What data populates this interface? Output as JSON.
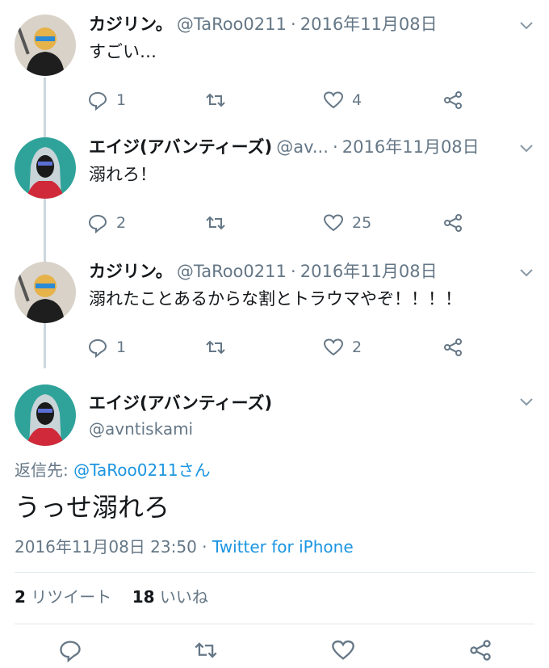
{
  "thread": [
    {
      "avatar_icon": "avatar-kajirin-icon",
      "name": "カジリン。",
      "handle": "@TaRoo0211",
      "separator": "·",
      "date": "2016年11月08日",
      "text": "すごい…",
      "replies": "1",
      "retweets": "",
      "likes": "4"
    },
    {
      "avatar_icon": "avatar-eiji-icon",
      "name": "エイジ(アバンティーズ)",
      "handle": "@av...",
      "separator": "·",
      "date": "2016年11月08日",
      "text": "溺れろ！",
      "replies": "2",
      "retweets": "",
      "likes": "25"
    },
    {
      "avatar_icon": "avatar-kajirin-icon",
      "name": "カジリン。",
      "handle": "@TaRoo0211",
      "separator": "·",
      "date": "2016年11月08日",
      "text": "溺れたことあるからな割とトラウマやぞ！！！！",
      "replies": "1",
      "retweets": "",
      "likes": "2"
    }
  ],
  "main_tweet": {
    "avatar_icon": "avatar-eiji-icon",
    "name": "エイジ(アバンティーズ)",
    "handle": "@avntiskami",
    "reply_label": "返信先: ",
    "reply_target": "@TaRoo0211さん",
    "text": "うっせ溺れろ",
    "timestamp": "2016年11月08日 23:50",
    "meta_separator": " · ",
    "client": "Twitter for iPhone",
    "retweet_count": "2",
    "retweet_label": " リツイート",
    "like_count": "18",
    "like_label": " いいね"
  },
  "colors": {
    "text": "#14171a",
    "secondary": "#657786",
    "link": "#1b95e0",
    "thread_line": "#ccd6dd",
    "divider": "#e1e8ed"
  }
}
